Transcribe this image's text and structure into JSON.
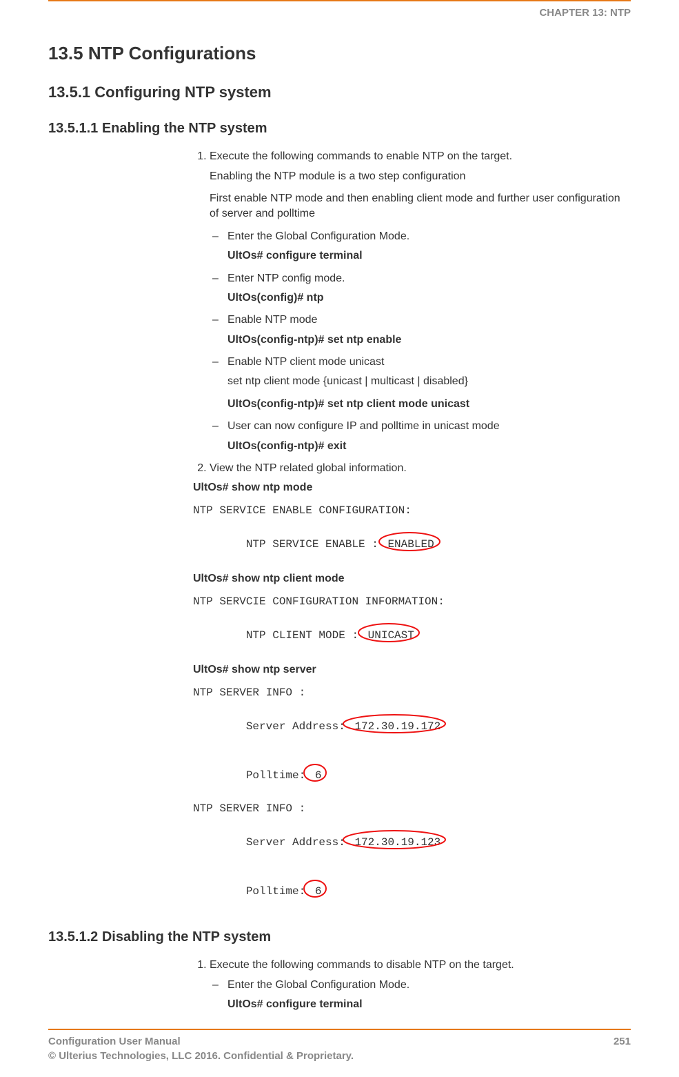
{
  "chapter_label": "CHAPTER 13: NTP",
  "h_13_5": "13.5 NTP Configurations",
  "h_13_5_1": "13.5.1   Configuring NTP system",
  "h_13_5_1_1": "13.5.1.1   Enabling the NTP system",
  "sec1": {
    "step1_text": "Execute the following commands to enable NTP on the target.",
    "para1": "Enabling the NTP module is a two step configuration",
    "para2": "First enable NTP mode and then enabling client mode and further user configuration of server and polltime",
    "dashes": [
      {
        "text": "Enter the Global Configuration Mode.",
        "cmd": "UltOs# configure terminal"
      },
      {
        "text": "Enter NTP config mode.",
        "cmd": "UltOs(config)# ntp"
      },
      {
        "text": "Enable NTP mode",
        "cmd": "UltOs(config-ntp)#  set ntp enable"
      },
      {
        "text": "Enable NTP client mode unicast",
        "extra": "set ntp client mode {unicast | multicast | disabled}",
        "cmd": "UltOs(config-ntp)# set ntp client mode unicast"
      },
      {
        "text": "User can now configure IP and polltime in unicast mode",
        "cmd": "UltOs(config-ntp)# exit"
      }
    ],
    "step2_text": "View the NTP related global information.",
    "out": {
      "cmd1": "UltOs# show ntp mode",
      "line1": "NTP SERVICE ENABLE CONFIGURATION:",
      "line2_pre": "NTP SERVICE ENABLE : ",
      "line2_val": "ENABLED",
      "cmd2": "UltOs# show ntp client mode",
      "line3": "NTP SERVCIE CONFIGURATION INFORMATION:",
      "line4_pre": "NTP CLIENT MODE : ",
      "line4_val": "UNICAST",
      "cmd3": "UltOs# show ntp server",
      "line5": "NTP SERVER INFO :",
      "line6_pre": "Server Address: ",
      "line6_val": "172.30.19.172",
      "line7_pre": "Polltime: ",
      "line7_val": "6",
      "line8": "NTP SERVER INFO :",
      "line9_pre": "Server Address: ",
      "line9_val": "172.30.19.123",
      "line10_pre": "Polltime: ",
      "line10_val": "6"
    }
  },
  "h_13_5_1_2": "13.5.1.2   Disabling the NTP system",
  "sec2": {
    "step1_text": "Execute the following commands to disable NTP on the target.",
    "dashes": [
      {
        "text": "Enter the Global Configuration Mode.",
        "cmd": "UltOs# configure terminal"
      }
    ]
  },
  "footer": {
    "title": "Configuration User Manual",
    "copyright": "© Ulterius Technologies, LLC 2016. Confidential & Proprietary.",
    "page": "251"
  },
  "circle_stroke": "#e11"
}
